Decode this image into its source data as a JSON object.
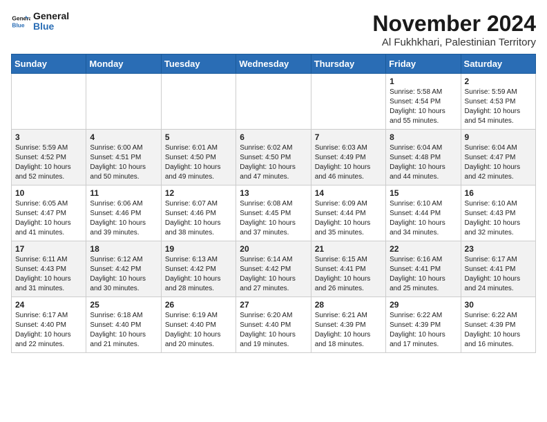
{
  "logo": {
    "line1": "General",
    "line2": "Blue"
  },
  "header": {
    "month": "November 2024",
    "location": "Al Fukhkhari, Palestinian Territory"
  },
  "weekdays": [
    "Sunday",
    "Monday",
    "Tuesday",
    "Wednesday",
    "Thursday",
    "Friday",
    "Saturday"
  ],
  "weeks": [
    [
      {
        "day": "",
        "info": ""
      },
      {
        "day": "",
        "info": ""
      },
      {
        "day": "",
        "info": ""
      },
      {
        "day": "",
        "info": ""
      },
      {
        "day": "",
        "info": ""
      },
      {
        "day": "1",
        "info": "Sunrise: 5:58 AM\nSunset: 4:54 PM\nDaylight: 10 hours\nand 55 minutes."
      },
      {
        "day": "2",
        "info": "Sunrise: 5:59 AM\nSunset: 4:53 PM\nDaylight: 10 hours\nand 54 minutes."
      }
    ],
    [
      {
        "day": "3",
        "info": "Sunrise: 5:59 AM\nSunset: 4:52 PM\nDaylight: 10 hours\nand 52 minutes."
      },
      {
        "day": "4",
        "info": "Sunrise: 6:00 AM\nSunset: 4:51 PM\nDaylight: 10 hours\nand 50 minutes."
      },
      {
        "day": "5",
        "info": "Sunrise: 6:01 AM\nSunset: 4:50 PM\nDaylight: 10 hours\nand 49 minutes."
      },
      {
        "day": "6",
        "info": "Sunrise: 6:02 AM\nSunset: 4:50 PM\nDaylight: 10 hours\nand 47 minutes."
      },
      {
        "day": "7",
        "info": "Sunrise: 6:03 AM\nSunset: 4:49 PM\nDaylight: 10 hours\nand 46 minutes."
      },
      {
        "day": "8",
        "info": "Sunrise: 6:04 AM\nSunset: 4:48 PM\nDaylight: 10 hours\nand 44 minutes."
      },
      {
        "day": "9",
        "info": "Sunrise: 6:04 AM\nSunset: 4:47 PM\nDaylight: 10 hours\nand 42 minutes."
      }
    ],
    [
      {
        "day": "10",
        "info": "Sunrise: 6:05 AM\nSunset: 4:47 PM\nDaylight: 10 hours\nand 41 minutes."
      },
      {
        "day": "11",
        "info": "Sunrise: 6:06 AM\nSunset: 4:46 PM\nDaylight: 10 hours\nand 39 minutes."
      },
      {
        "day": "12",
        "info": "Sunrise: 6:07 AM\nSunset: 4:46 PM\nDaylight: 10 hours\nand 38 minutes."
      },
      {
        "day": "13",
        "info": "Sunrise: 6:08 AM\nSunset: 4:45 PM\nDaylight: 10 hours\nand 37 minutes."
      },
      {
        "day": "14",
        "info": "Sunrise: 6:09 AM\nSunset: 4:44 PM\nDaylight: 10 hours\nand 35 minutes."
      },
      {
        "day": "15",
        "info": "Sunrise: 6:10 AM\nSunset: 4:44 PM\nDaylight: 10 hours\nand 34 minutes."
      },
      {
        "day": "16",
        "info": "Sunrise: 6:10 AM\nSunset: 4:43 PM\nDaylight: 10 hours\nand 32 minutes."
      }
    ],
    [
      {
        "day": "17",
        "info": "Sunrise: 6:11 AM\nSunset: 4:43 PM\nDaylight: 10 hours\nand 31 minutes."
      },
      {
        "day": "18",
        "info": "Sunrise: 6:12 AM\nSunset: 4:42 PM\nDaylight: 10 hours\nand 30 minutes."
      },
      {
        "day": "19",
        "info": "Sunrise: 6:13 AM\nSunset: 4:42 PM\nDaylight: 10 hours\nand 28 minutes."
      },
      {
        "day": "20",
        "info": "Sunrise: 6:14 AM\nSunset: 4:42 PM\nDaylight: 10 hours\nand 27 minutes."
      },
      {
        "day": "21",
        "info": "Sunrise: 6:15 AM\nSunset: 4:41 PM\nDaylight: 10 hours\nand 26 minutes."
      },
      {
        "day": "22",
        "info": "Sunrise: 6:16 AM\nSunset: 4:41 PM\nDaylight: 10 hours\nand 25 minutes."
      },
      {
        "day": "23",
        "info": "Sunrise: 6:17 AM\nSunset: 4:41 PM\nDaylight: 10 hours\nand 24 minutes."
      }
    ],
    [
      {
        "day": "24",
        "info": "Sunrise: 6:17 AM\nSunset: 4:40 PM\nDaylight: 10 hours\nand 22 minutes."
      },
      {
        "day": "25",
        "info": "Sunrise: 6:18 AM\nSunset: 4:40 PM\nDaylight: 10 hours\nand 21 minutes."
      },
      {
        "day": "26",
        "info": "Sunrise: 6:19 AM\nSunset: 4:40 PM\nDaylight: 10 hours\nand 20 minutes."
      },
      {
        "day": "27",
        "info": "Sunrise: 6:20 AM\nSunset: 4:40 PM\nDaylight: 10 hours\nand 19 minutes."
      },
      {
        "day": "28",
        "info": "Sunrise: 6:21 AM\nSunset: 4:39 PM\nDaylight: 10 hours\nand 18 minutes."
      },
      {
        "day": "29",
        "info": "Sunrise: 6:22 AM\nSunset: 4:39 PM\nDaylight: 10 hours\nand 17 minutes."
      },
      {
        "day": "30",
        "info": "Sunrise: 6:22 AM\nSunset: 4:39 PM\nDaylight: 10 hours\nand 16 minutes."
      }
    ]
  ]
}
